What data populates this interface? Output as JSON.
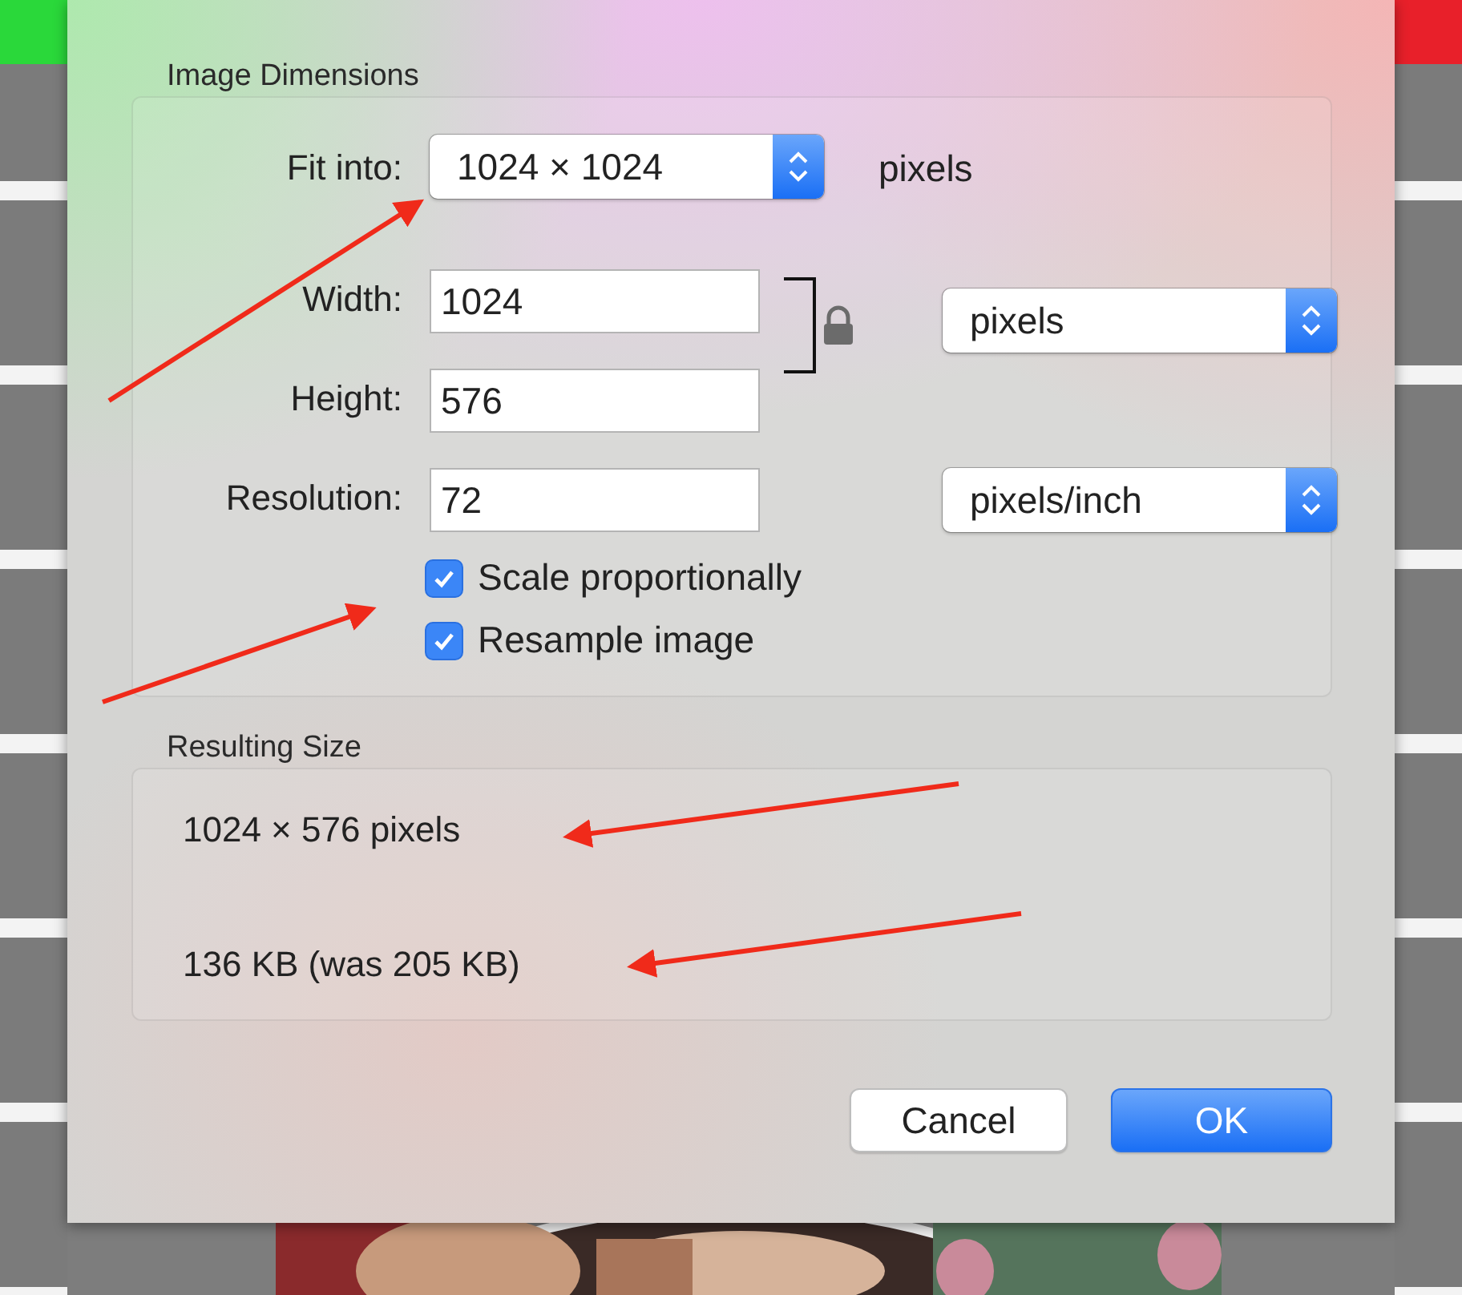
{
  "image_dimensions": {
    "title": "Image Dimensions",
    "fit_into": {
      "label": "Fit into:",
      "value": "1024 × 1024",
      "unit": "pixels"
    },
    "width": {
      "label": "Width:",
      "value": "1024"
    },
    "height": {
      "label": "Height:",
      "value": "576"
    },
    "size_unit": "pixels",
    "locked": true,
    "resolution": {
      "label": "Resolution:",
      "value": "72",
      "unit": "pixels/inch"
    },
    "checkboxes": [
      {
        "label": "Scale proportionally",
        "checked": true
      },
      {
        "label": "Resample image",
        "checked": true
      }
    ]
  },
  "resulting_size": {
    "title": "Resulting Size",
    "dimensions": "1024 × 576 pixels",
    "file_size": "136 KB (was 205 KB)"
  },
  "buttons": [
    {
      "label": "Cancel",
      "kind": "secondary"
    },
    {
      "label": "OK",
      "kind": "default"
    }
  ]
}
